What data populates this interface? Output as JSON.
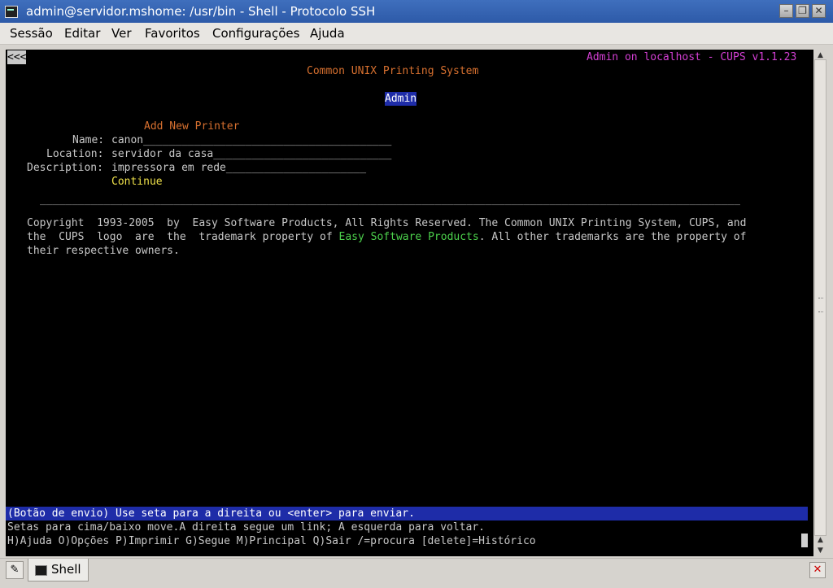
{
  "window": {
    "title": "admin@servidor.mshome: /usr/bin - Shell - Protocolo SSH",
    "minimize_glyph": "–",
    "maximize_glyph": "❐",
    "close_glyph": "✕"
  },
  "menu": [
    "Sessão",
    "Editar",
    "Ver",
    "Favoritos",
    "Configurações",
    "Ajuda"
  ],
  "terminal": {
    "back_link": "<<<",
    "header_right": "Admin on localhost - CUPS v1.1.23",
    "system_title": "Common UNIX Printing System",
    "admin_button": "Admin",
    "form_title": "Add New Printer",
    "fields": [
      {
        "label": "Name:",
        "value": "canon"
      },
      {
        "label": "Location:",
        "value": "servidor da casa"
      },
      {
        "label": "Description:",
        "value": "impressora em rede"
      }
    ],
    "continue_button": "Continue",
    "copyright": {
      "line1": "Copyright  1993-2005  by  Easy Software Products, All Rights Reserved. The Common UNIX Printing System, CUPS, and",
      "line2_prefix": "the  CUPS  logo  are  the  trademark property of ",
      "line2_link": "Easy Software Products",
      "line2_suffix": ". All other trademarks are the property of",
      "line3": "their respective owners."
    },
    "status_line": "(Botão de envio) Use seta para a direita ou <enter> para enviar.",
    "help_line1": "Setas para cima/baixo move.A direita segue um link; A esquerda para voltar.",
    "help_line2": "H)Ajuda O)Opções P)Imprimir G)Segue M)Principal Q)Sair /=procura [delete]=Histórico"
  },
  "taskbar": {
    "tab_label": "Shell",
    "new_tab_glyph": "✎",
    "close_tab_glyph": "✕"
  },
  "colors": {
    "titlebar": "#2d5aa8",
    "terminal_bg": "#000000",
    "link_orange": "#d7702f",
    "header_magenta": "#d33fd3",
    "selected_yellow": "#f0e24a",
    "link_green": "#4cd14c",
    "status_blue": "#1e2ca8"
  }
}
